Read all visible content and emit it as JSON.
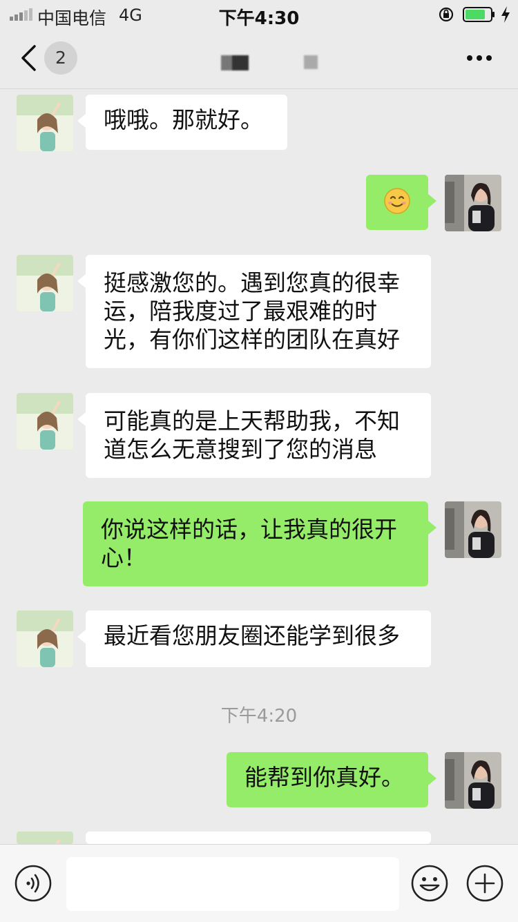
{
  "status_bar": {
    "carrier": "中国电信",
    "network": "4G",
    "time": "下午4:30"
  },
  "nav": {
    "unread_count": "2",
    "back_icon": "chevron-left-icon",
    "more_icon": "more-dots-icon"
  },
  "messages": [
    {
      "side": "in",
      "text": "哦哦。那就好。"
    },
    {
      "side": "out",
      "text": "😊"
    },
    {
      "side": "in",
      "text": "挺感激您的。遇到您真的很幸运，陪我度过了最艰难的时光，有你们这样的团队在真好"
    },
    {
      "side": "in",
      "text": "可能真的是上天帮助我，不知道怎么无意搜到了您的消息"
    },
    {
      "side": "out",
      "text": "你说这样的话，让我真的很开心！"
    },
    {
      "side": "in",
      "text": "最近看您朋友圈还能学到很多"
    },
    {
      "side": "out",
      "text": "能帮到你真好。"
    }
  ],
  "timestamp": "下午4:20",
  "input_bar": {
    "voice_icon": "voice-icon",
    "emoji_icon": "emoji-icon",
    "plus_icon": "plus-icon",
    "text_value": ""
  },
  "colors": {
    "background": "#ebebeb",
    "bubble_out": "#95ec69",
    "bubble_in": "#ffffff"
  }
}
